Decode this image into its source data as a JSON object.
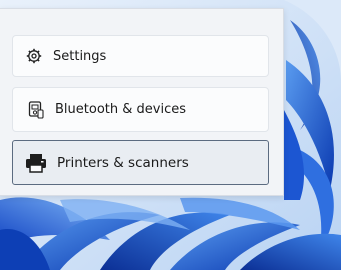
{
  "menu": {
    "items": [
      {
        "label": "Settings",
        "icon": "gear-icon"
      },
      {
        "label": "Bluetooth & devices",
        "icon": "bluetooth-devices-icon"
      },
      {
        "label": "Printers & scanners",
        "icon": "printer-icon"
      }
    ]
  },
  "colors": {
    "wallpaper_light": "#cfe0f7",
    "wallpaper_mid": "#3b7de0",
    "wallpaper_dark": "#0d3fb5",
    "selected_border": "#5b6b80"
  }
}
